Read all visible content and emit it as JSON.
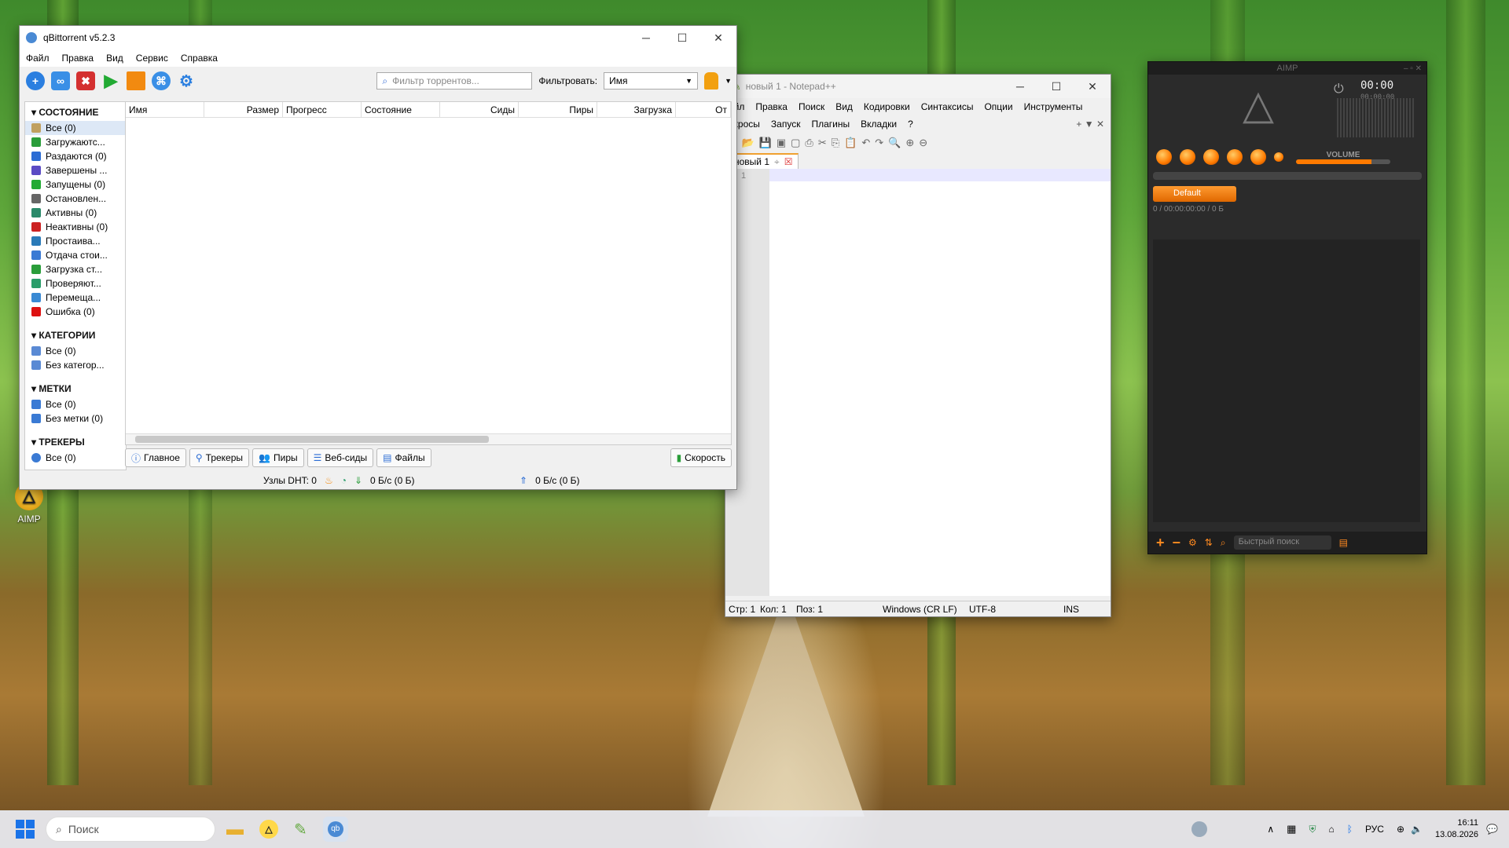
{
  "desktop": {
    "icons": [
      {
        "label": "AIMP"
      }
    ]
  },
  "qbt": {
    "title": "qBittorrent v5.2.3",
    "menu": [
      "Файл",
      "Правка",
      "Вид",
      "Сервис",
      "Справка"
    ],
    "filter_placeholder": "Фильтр торрентов...",
    "filter_label": "Фильтровать:",
    "filter_value": "Имя",
    "sections": {
      "state": "СОСТОЯНИЕ",
      "categories": "КАТЕГОРИИ",
      "tags": "МЕТКИ",
      "trackers": "ТРЕКЕРЫ"
    },
    "state_items": [
      {
        "label": "Все (0)",
        "color": "#c0a060"
      },
      {
        "label": "Загружаютс...",
        "color": "#2a9d3a"
      },
      {
        "label": "Раздаются (0)",
        "color": "#2b6cd4"
      },
      {
        "label": "Завершены ...",
        "color": "#5b4bc4"
      },
      {
        "label": "Запущены (0)",
        "color": "#22aa33"
      },
      {
        "label": "Остановлен...",
        "color": "#666666"
      },
      {
        "label": "Активны (0)",
        "color": "#2a8a6a"
      },
      {
        "label": "Неактивны (0)",
        "color": "#cc2222"
      },
      {
        "label": "Простаива...",
        "color": "#2a7ab8"
      },
      {
        "label": "Отдача стои...",
        "color": "#3a7ad4"
      },
      {
        "label": "Загрузка ст...",
        "color": "#2a9d3a"
      },
      {
        "label": "Проверяют...",
        "color": "#2a9d6a"
      },
      {
        "label": "Перемеща...",
        "color": "#3a8ad4"
      },
      {
        "label": "Ошибка (0)",
        "color": "#dd1111"
      }
    ],
    "category_items": [
      {
        "label": "Все (0)"
      },
      {
        "label": "Без категор..."
      }
    ],
    "tag_items": [
      {
        "label": "Все (0)"
      },
      {
        "label": "Без метки (0)"
      }
    ],
    "tracker_items": [
      {
        "label": "Все (0)"
      }
    ],
    "columns": [
      "Имя",
      "Размер",
      "Прогресс",
      "Состояние",
      "Сиды",
      "Пиры",
      "Загрузка",
      "От"
    ],
    "tabs": [
      "Главное",
      "Трекеры",
      "Пиры",
      "Веб-сиды",
      "Файлы"
    ],
    "speed_tab": "Скорость",
    "status": {
      "dht": "Узлы DHT: 0",
      "down": "0 Б/с (0 Б)",
      "up": "0 Б/с (0 Б)"
    }
  },
  "npp": {
    "title": "новый 1 - Notepad++",
    "menu1": [
      "Файл",
      "Правка",
      "Поиск",
      "Вид",
      "Кодировки",
      "Синтаксисы",
      "Опции",
      "Инструменты"
    ],
    "menu2": [
      "Макросы",
      "Запуск",
      "Плагины",
      "Вкладки",
      "?"
    ],
    "menu1_first": "айл",
    "menu2_first": "акросы",
    "tab": "новый 1",
    "line_no": "1",
    "status": {
      "line": "Стр: 1",
      "col": "Кол: 1",
      "pos": "Поз: 1",
      "eol": "Windows (CR LF)",
      "enc": "UTF-8",
      "mode": "INS"
    }
  },
  "aimp": {
    "title": "AIMP",
    "time": "00:00",
    "time_small": "00:00:00",
    "volume": "VOLUME",
    "playlist": "Default",
    "info": "0 / 00:00:00:00 / 0 Б",
    "search": "Быстрый поиск"
  },
  "taskbar": {
    "search": "Поиск",
    "lang": "РУС",
    "time": "16:11",
    "date": "13.08.2026"
  }
}
